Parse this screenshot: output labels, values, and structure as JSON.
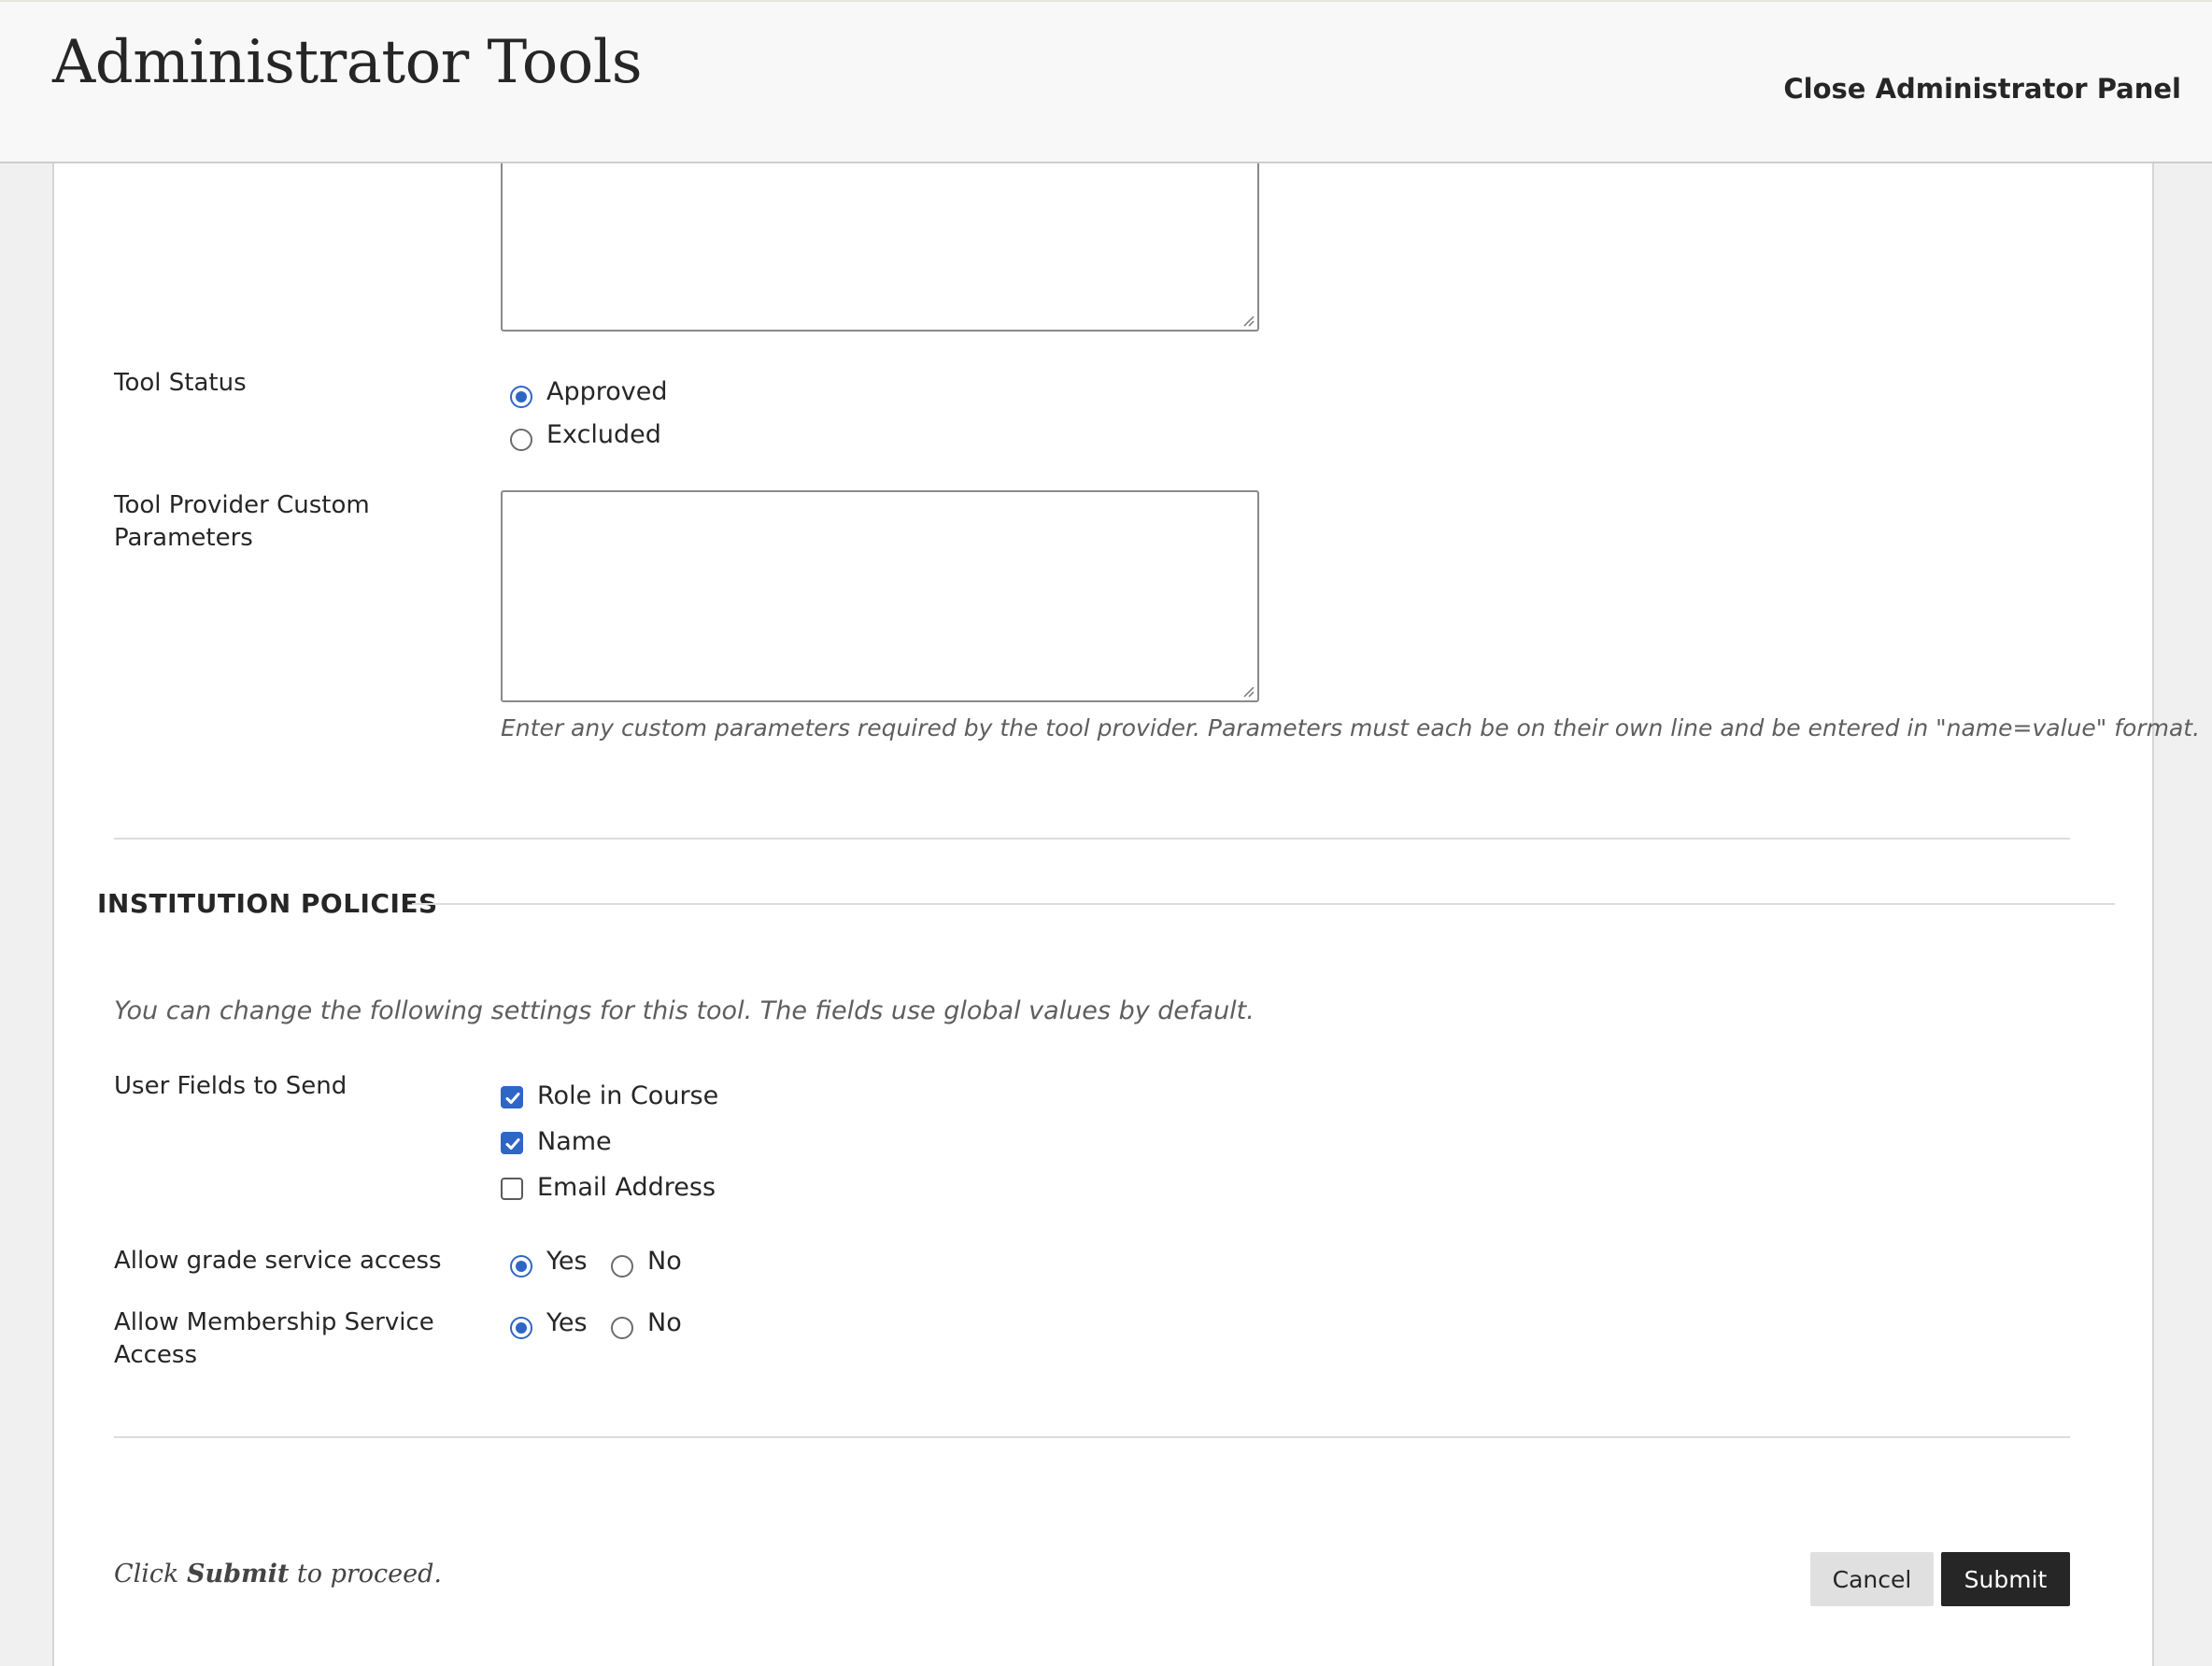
{
  "header": {
    "title": "Administrator Tools",
    "close_label": "Close Administrator Panel"
  },
  "form": {
    "tool_status": {
      "label": "Tool Status",
      "options": [
        {
          "label": "Approved",
          "selected": true
        },
        {
          "label": "Excluded",
          "selected": false
        }
      ]
    },
    "custom_params": {
      "label_line1": "Tool Provider Custom",
      "label_line2": "Parameters",
      "value": "",
      "help": "Enter any custom parameters required by the tool provider. Parameters must each be on their own line and be entered in \"name=value\" format."
    }
  },
  "institution_policies": {
    "title": "INSTITUTION POLICIES",
    "intro": "You can change the following settings for this tool. The fields use global values by default.",
    "user_fields": {
      "label": "User Fields to Send",
      "options": [
        {
          "label": "Role in Course",
          "checked": true
        },
        {
          "label": "Name",
          "checked": true
        },
        {
          "label": "Email Address",
          "checked": false
        }
      ]
    },
    "grade_service": {
      "label": "Allow grade service access",
      "yes": "Yes",
      "no": "No",
      "selected": "Yes"
    },
    "membership_service": {
      "label_line1": "Allow Membership Service",
      "label_line2": "Access",
      "yes": "Yes",
      "no": "No",
      "selected": "Yes"
    }
  },
  "footer": {
    "note_prefix": "Click",
    "note_bold": "Submit",
    "note_suffix": "to proceed.",
    "cancel_label": "Cancel",
    "submit_label": "Submit"
  },
  "colors": {
    "accent": "#2f66c6",
    "submit_bg": "#262626",
    "cancel_bg": "#e0e0e0"
  }
}
